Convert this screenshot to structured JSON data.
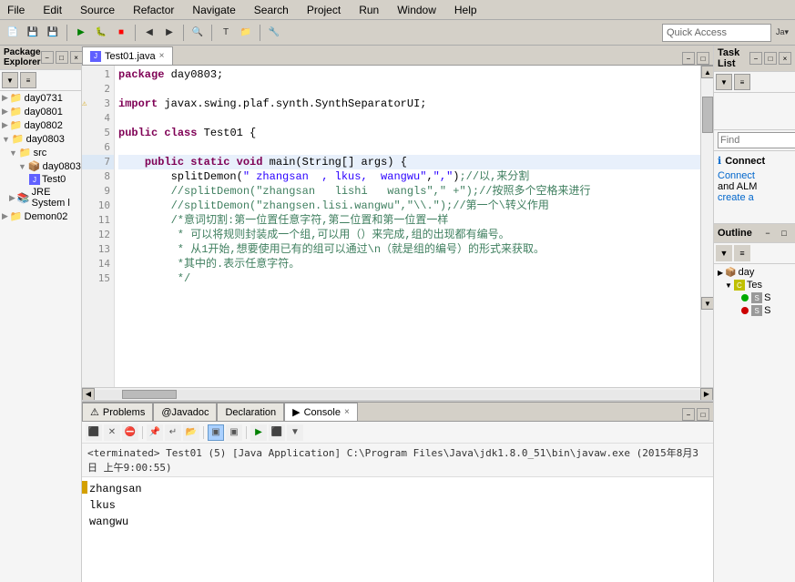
{
  "menubar": {
    "items": [
      "File",
      "Edit",
      "Source",
      "Refactor",
      "Navigate",
      "Search",
      "Project",
      "Run",
      "Window",
      "Help"
    ]
  },
  "toolbar": {
    "quick_access_placeholder": "Quick Access"
  },
  "editor": {
    "tab_label": "Test01.java",
    "tab_close": "×",
    "window_controls": {
      "minimize": "−",
      "maximize": "□",
      "close": "×"
    }
  },
  "code_lines": [
    {
      "num": 1,
      "text": "package day0803;"
    },
    {
      "num": 2,
      "text": ""
    },
    {
      "num": 3,
      "text": "import javax.swing.plaf.synth.SynthSeparatorUI;"
    },
    {
      "num": 4,
      "text": ""
    },
    {
      "num": 5,
      "text": "public class Test01 {"
    },
    {
      "num": 6,
      "text": ""
    },
    {
      "num": 7,
      "text": "    public static void main(String[] args) {"
    },
    {
      "num": 8,
      "text": "        splitDemon(\" zhangsan  , lkus,  wangwu\",\",\");//以,来分割"
    },
    {
      "num": 9,
      "text": "        //splitDemon(\"zhangsan   lishi   wangls\",\" +\");//按照多个空格来进行"
    },
    {
      "num": 10,
      "text": "        //splitDemon(\"zhangsen.lisi.wangwu\",\"\\\\.\");//第一个\\转义作用"
    },
    {
      "num": 11,
      "text": "        /*意词切割:第一位置任意字符,第二位置和第一位置一样"
    },
    {
      "num": 12,
      "text": "         * 可以将规则封装成一个组,可以用（）来完成,组的出现都有编号。"
    },
    {
      "num": 13,
      "text": "         * 从1开始,想要使用已有的组可以通过\\n（就是组的编号）的形式来获取。"
    },
    {
      "num": 14,
      "text": "         *其中的.表示任意字符。"
    },
    {
      "num": 15,
      "text": "         */"
    }
  ],
  "left_panel": {
    "items": [
      {
        "label": "day0731",
        "indent": 0,
        "icon": "folder"
      },
      {
        "label": "day0801",
        "indent": 0,
        "icon": "folder"
      },
      {
        "label": "day0802",
        "indent": 0,
        "icon": "folder"
      },
      {
        "label": "day0803",
        "indent": 0,
        "icon": "folder",
        "expanded": true
      },
      {
        "label": "src",
        "indent": 1,
        "icon": "folder",
        "expanded": true
      },
      {
        "label": "day0803",
        "indent": 2,
        "icon": "package",
        "expanded": true
      },
      {
        "label": "Test0",
        "indent": 3,
        "icon": "java"
      },
      {
        "label": "JRE System l",
        "indent": 1,
        "icon": "library"
      },
      {
        "label": "Demon02",
        "indent": 0,
        "icon": "folder"
      }
    ]
  },
  "bottom_tabs": [
    {
      "label": "Problems",
      "active": false,
      "icon": "⚠"
    },
    {
      "label": "@Javadoc",
      "active": false,
      "icon": ""
    },
    {
      "label": "Declaration",
      "active": false,
      "icon": ""
    },
    {
      "label": "Console",
      "active": true,
      "icon": "▶",
      "close": "×"
    }
  ],
  "console": {
    "terminated_text": "<terminated> Test01 (5) [Java Application] C:\\Program Files\\Java\\jdk1.8.0_51\\bin\\javaw.exe (2015年8月3日 上午9:00:55)",
    "output_lines": [
      "zhangsan",
      "lkus",
      "wangwu"
    ]
  },
  "right_top_panel": {
    "title": "Task List",
    "controls": [
      "−",
      "□",
      "×"
    ]
  },
  "right_find_bar": {
    "placeholder": "Find",
    "button": "🔍"
  },
  "right_middle_panel": {
    "title": "Connect",
    "connect_label": "Connect",
    "alm_label": "and ALM",
    "create_label": "create a"
  },
  "outline_panel": {
    "title": "Outline",
    "controls": [
      "−",
      "□"
    ],
    "items": [
      {
        "label": "day",
        "indent": 0,
        "icon": "▶",
        "type": "package"
      },
      {
        "label": "Tes",
        "indent": 1,
        "icon": "▼",
        "type": "class"
      },
      {
        "label": "S",
        "indent": 2,
        "icon": "",
        "type": "field",
        "dot": "green"
      },
      {
        "label": "S",
        "indent": 2,
        "icon": "",
        "type": "field",
        "dot": "red"
      }
    ]
  },
  "console_toolbar_buttons": [
    "⬛",
    "✕",
    "⛔",
    "📋",
    "❌",
    "📄",
    "📄",
    "⬛",
    "⬛",
    "⬛",
    "⬛",
    "▶",
    "⬛",
    "⬛",
    "⬛",
    "⬛"
  ]
}
